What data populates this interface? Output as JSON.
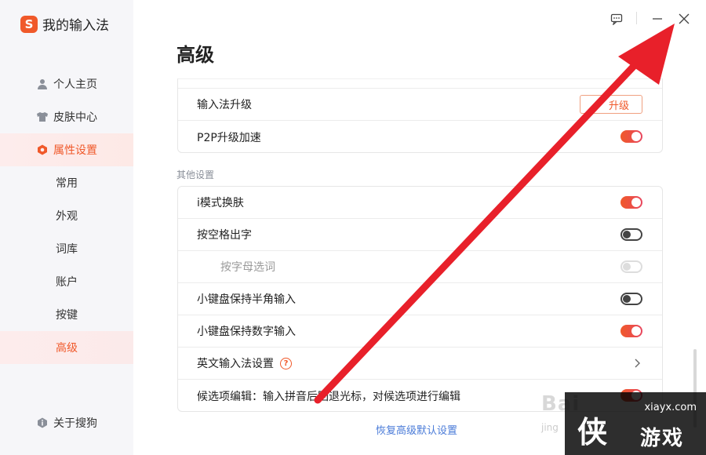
{
  "app": {
    "title": "我的输入法",
    "logo_letter": "S"
  },
  "sidebar": {
    "items": [
      {
        "label": "个人主页",
        "icon": "user-icon"
      },
      {
        "label": "皮肤中心",
        "icon": "shirt-icon"
      },
      {
        "label": "属性设置",
        "icon": "hexagon-gear-icon"
      }
    ],
    "sub_items": [
      "常用",
      "外观",
      "词库",
      "账户",
      "按键",
      "高级"
    ],
    "about": {
      "label": "关于搜狗",
      "icon": "info-icon"
    }
  },
  "main": {
    "title": "高级",
    "top_card": [
      {
        "label": "输入法升级",
        "control": "button",
        "button_label": "升级"
      },
      {
        "label": "P2P升级加速",
        "control": "toggle",
        "state": "on"
      }
    ],
    "section_label": "其他设置",
    "other_card": [
      {
        "label": "i模式换肤",
        "control": "toggle",
        "state": "on"
      },
      {
        "label": "按空格出字",
        "control": "toggle",
        "state": "off"
      },
      {
        "label": "按字母选词",
        "control": "toggle",
        "state": "disabled"
      },
      {
        "label": "小键盘保持半角输入",
        "control": "toggle",
        "state": "off"
      },
      {
        "label": "小键盘保持数字输入",
        "control": "toggle",
        "state": "on"
      },
      {
        "label": "英文输入法设置",
        "control": "chevron",
        "help": "?"
      },
      {
        "label": "候选项编辑：输入拼音后回退光标，对候选项进行编辑",
        "control": "toggle",
        "state": "on"
      }
    ],
    "reset_link": "恢复高级默认设置"
  },
  "watermark": {
    "baidu": "Bai",
    "jingyan": "jing",
    "site": "xiayx.com",
    "logo": "侠",
    "brand": "游戏"
  },
  "colors": {
    "accent": "#f0592a",
    "link": "#4a7bd8",
    "arrow": "#e8202a"
  }
}
